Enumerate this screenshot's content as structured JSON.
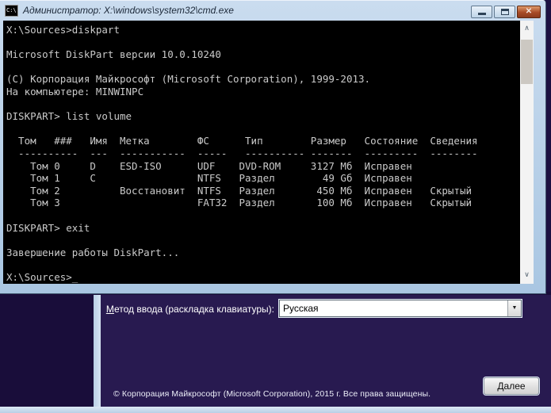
{
  "titlebar": {
    "title": "Администратор: X:\\windows\\system32\\cmd.exe",
    "icon_label": "C:\\",
    "close_glyph": "✕"
  },
  "console": {
    "lines": [
      "X:\\Sources>diskpart",
      "",
      "Microsoft DiskPart версии 10.0.10240",
      "",
      "(C) Корпорация Майкрософт (Microsoft Corporation), 1999-2013.",
      "На компьютере: MINWINPC",
      "",
      "DISKPART> list volume",
      "",
      "  Том   ###   Имя  Метка        ФС      Тип        Размер   Состояние  Сведения",
      "  ----------  ---  -----------  -----   ---------- -------  ---------  --------",
      "    Том 0     D    ESD-ISO      UDF    DVD-ROM     3127 Мб  Исправен",
      "    Том 1     C                 NTFS   Раздел        49 Gб  Исправен",
      "    Том 2          Восстановит  NTFS   Раздел       450 Мб  Исправен   Скрытый",
      "    Том 3                       FAT32  Раздел       100 Мб  Исправен   Скрытый",
      "",
      "DISKPART> exit",
      "",
      "Завершение работы DiskPart...",
      "",
      "X:\\Sources>_"
    ],
    "volumes_table": {
      "headers": [
        "Том",
        "###",
        "Имя",
        "Метка",
        "ФС",
        "Тип",
        "Размер",
        "Состояние",
        "Сведения"
      ],
      "rows": [
        [
          "Том 0",
          "D",
          "ESD-ISO",
          "UDF",
          "DVD-ROM",
          "3127 Мб",
          "Исправен",
          ""
        ],
        [
          "Том 1",
          "C",
          "",
          "NTFS",
          "Раздел",
          "49 Gб",
          "Исправен",
          ""
        ],
        [
          "Том 2",
          "",
          "Восстановит",
          "NTFS",
          "Раздел",
          "450 Мб",
          "Исправен",
          "Скрытый"
        ],
        [
          "Том 3",
          "",
          "",
          "FAT32",
          "Раздел",
          "100 Мб",
          "Исправен",
          "Скрытый"
        ]
      ]
    }
  },
  "scrollbar": {
    "up_glyph": "∧",
    "down_glyph": "∨"
  },
  "dialog": {
    "keyboard_label": {
      "accesskey": "М",
      "rest": "етод ввода (раскладка клавиатуры):"
    },
    "keyboard_select": {
      "value": "Русская",
      "arrow_glyph": "▼"
    },
    "copyright": "© Корпорация Майкрософт (Microsoft Corporation), 2015 г. Все права защищены.",
    "next_button": {
      "accesskey": "Д",
      "rest": "алее"
    }
  },
  "colors": {
    "console_background": "#000000",
    "console_text": "#cacaca",
    "setup_background": "#281a50",
    "desktop_background": "#190d3a",
    "aero_frame": "#b3cfe9",
    "close_button": "#a74a26"
  }
}
